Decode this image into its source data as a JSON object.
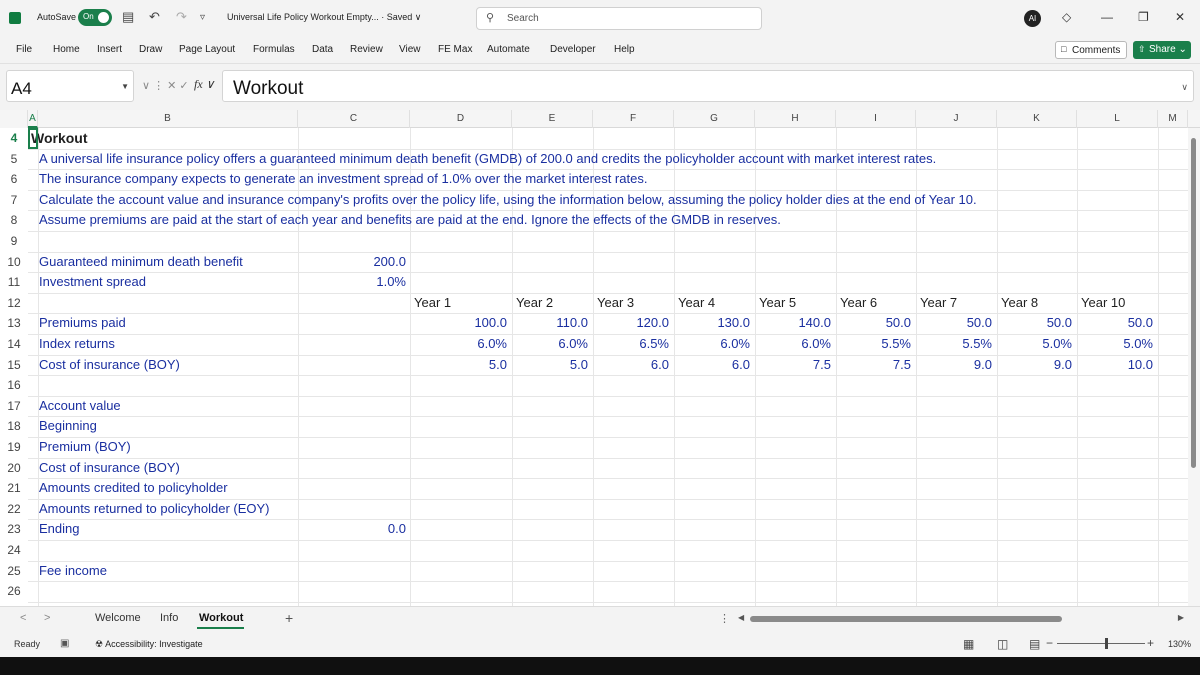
{
  "app": {
    "autosave_label": "AutoSave",
    "autosave_state": "On",
    "file_title": "Universal Life Policy Workout Empty... · Saved ∨",
    "search_placeholder": "Search",
    "undo_glyph": "↶",
    "redo_glyph": "↷",
    "save_glyph": "▤",
    "customize_glyph": "▿",
    "copilot_glyph": "AI",
    "diamond_glyph": "◇",
    "minimize_glyph": "—",
    "restore_glyph": "❐",
    "close_glyph": "✕",
    "brand_color": "#1a7f4b",
    "accent_text_color": "#1a2fa0"
  },
  "ribbon": {
    "tabs": [
      "File",
      "Home",
      "Insert",
      "Draw",
      "Page Layout",
      "Formulas",
      "Data",
      "Review",
      "View",
      "FE Max",
      "Automate",
      "Developer",
      "Help"
    ],
    "comments_label": "Comments",
    "share_label": "Share ⌄"
  },
  "formula_bar": {
    "name_box": "A4",
    "controls": "∨  ⋮  ✕  ✓",
    "fx": "fx ∨",
    "value": "Workout"
  },
  "grid": {
    "columns": [
      "A",
      "B",
      "C",
      "D",
      "E",
      "F",
      "G",
      "H",
      "I",
      "J",
      "K",
      "L",
      "M"
    ],
    "active_column": "A",
    "rows": [
      "4",
      "5",
      "6",
      "7",
      "8",
      "9",
      "10",
      "11",
      "12",
      "13",
      "14",
      "15",
      "16",
      "17",
      "18",
      "19",
      "20",
      "21",
      "22",
      "23",
      "24",
      "25",
      "26"
    ],
    "active_row": "4",
    "title": "Workout",
    "description": [
      "A universal life insurance policy offers a guaranteed minimum death benefit (GMDB) of 200.0 and credits the policyholder account with market interest rates.",
      "The insurance company expects to generate an investment spread of 1.0% over the market interest rates.",
      "Calculate the account value and insurance company's profits over the policy life, using the information below, assuming the policy holder dies at the end of Year 10.",
      "Assume premiums are paid at the start of each year and benefits are paid at the end. Ignore the effects of the GMDB in reserves."
    ],
    "inputs": [
      {
        "label": "Guaranteed minimum death benefit",
        "value": "200.0"
      },
      {
        "label": "Investment spread",
        "value": "1.0%"
      }
    ],
    "years": [
      "Year 1",
      "Year 2",
      "Year 3",
      "Year 4",
      "Year 5",
      "Year 6",
      "Year 7",
      "Year 8",
      "Year 10"
    ],
    "assumptions": [
      {
        "label": "Premiums paid",
        "values": [
          "100.0",
          "110.0",
          "120.0",
          "130.0",
          "140.0",
          "50.0",
          "50.0",
          "50.0",
          "50.0"
        ]
      },
      {
        "label": "Index returns",
        "values": [
          "6.0%",
          "6.0%",
          "6.5%",
          "6.0%",
          "6.0%",
          "5.5%",
          "5.5%",
          "5.0%",
          "5.0%"
        ]
      },
      {
        "label": "Cost of insurance (BOY)",
        "values": [
          "5.0",
          "5.0",
          "6.0",
          "6.0",
          "7.5",
          "7.5",
          "9.0",
          "9.0",
          "10.0"
        ]
      }
    ],
    "account_section": {
      "heading": "Account value",
      "items": [
        "Beginning",
        "Premium (BOY)",
        "Cost of insurance (BOY)",
        "Amounts credited to policyholder",
        "Amounts returned to policyholder (EOY)",
        "Ending"
      ],
      "ending_value": "0.0"
    },
    "fee_income_label": "Fee income"
  },
  "sheet_tabs": {
    "nav_prev": "<",
    "nav_next": ">",
    "tabs": [
      "Welcome",
      "Info",
      "Workout"
    ],
    "active": "Workout",
    "add_glyph": "+",
    "more_glyph": "⋮"
  },
  "status_bar": {
    "ready": "Ready",
    "accessibility": "Accessibility: Investigate",
    "zoom": "130%",
    "zoom_fraction": 0.55
  }
}
